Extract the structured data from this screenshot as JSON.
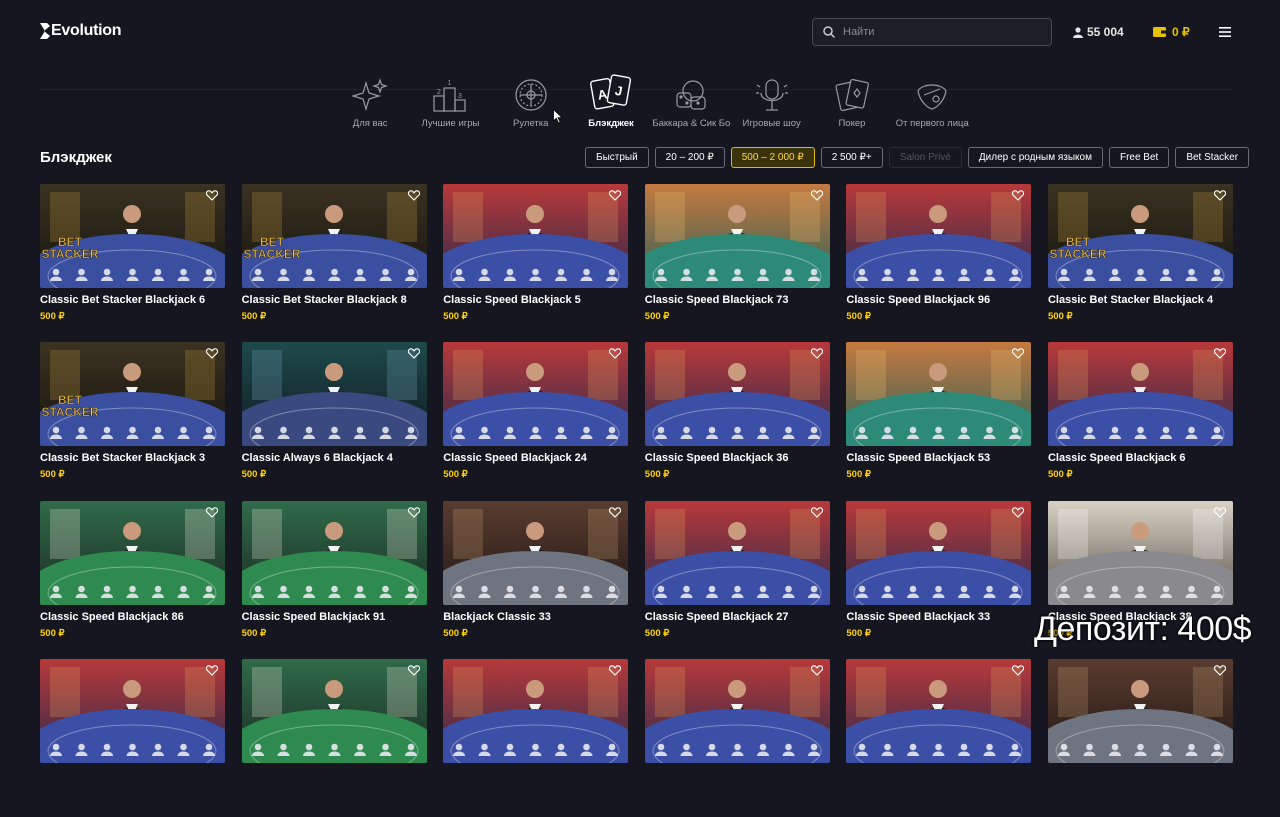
{
  "brand": "Evolution",
  "search": {
    "placeholder": "Найти"
  },
  "header": {
    "players": "55 004",
    "balance": "0 ₽"
  },
  "categories": [
    {
      "label": "Для вас",
      "icon": "sparkles-icon",
      "active": false
    },
    {
      "label": "Лучшие игры",
      "icon": "podium-icon",
      "active": false
    },
    {
      "label": "Рулетка",
      "icon": "roulette-icon",
      "active": false
    },
    {
      "label": "Блэкджек",
      "icon": "cards-icon",
      "active": true
    },
    {
      "label": "Баккара & Сик Бо",
      "icon": "dice-icon",
      "active": false
    },
    {
      "label": "Игровые шоу",
      "icon": "microphone-icon",
      "active": false
    },
    {
      "label": "Покер",
      "icon": "poker-cards-icon",
      "active": false
    },
    {
      "label": "От первого лица",
      "icon": "first-person-icon",
      "active": false
    }
  ],
  "section": {
    "title": "Блэкджек"
  },
  "filters": [
    {
      "label": "Быстрый",
      "state": "normal"
    },
    {
      "label": "20 – 200 ₽",
      "state": "normal"
    },
    {
      "label": "500 – 2 000 ₽",
      "state": "selected"
    },
    {
      "label": "2 500 ₽+",
      "state": "normal"
    },
    {
      "label": "Salon Privé",
      "state": "disabled"
    },
    {
      "label": "Дилер с родным языком",
      "state": "normal"
    },
    {
      "label": "Free Bet",
      "state": "normal"
    },
    {
      "label": "Bet Stacker",
      "state": "normal"
    }
  ],
  "games": [
    {
      "title": "Classic Bet Stacker Blackjack 6",
      "price": "500 ₽",
      "theme": "stacker"
    },
    {
      "title": "Classic Bet Stacker Blackjack 8",
      "price": "500 ₽",
      "theme": "stacker"
    },
    {
      "title": "Classic Speed Blackjack 5",
      "price": "500 ₽",
      "theme": "speed"
    },
    {
      "title": "Classic Speed Blackjack 73",
      "price": "500 ₽",
      "theme": "green"
    },
    {
      "title": "Classic Speed Blackjack 96",
      "price": "500 ₽",
      "theme": "speed"
    },
    {
      "title": "Classic Bet Stacker Blackjack 4",
      "price": "500 ₽",
      "theme": "stacker"
    },
    {
      "title": "Classic Bet Stacker Blackjack 3",
      "price": "500 ₽",
      "theme": "stacker"
    },
    {
      "title": "Classic Always 6 Blackjack 4",
      "price": "500 ₽",
      "theme": "always6"
    },
    {
      "title": "Classic Speed Blackjack 24",
      "price": "500 ₽",
      "theme": "speed"
    },
    {
      "title": "Classic Speed Blackjack 36",
      "price": "500 ₽",
      "theme": "speed"
    },
    {
      "title": "Classic Speed Blackjack 53",
      "price": "500 ₽",
      "theme": "green"
    },
    {
      "title": "Classic Speed Blackjack 6",
      "price": "500 ₽",
      "theme": "speed"
    },
    {
      "title": "Classic Speed Blackjack 86",
      "price": "500 ₽",
      "theme": "greenroom"
    },
    {
      "title": "Classic Speed Blackjack 91",
      "price": "500 ₽",
      "theme": "greenroom"
    },
    {
      "title": "Blackjack Classic 33",
      "price": "500 ₽",
      "theme": "classic"
    },
    {
      "title": "Classic Speed Blackjack 27",
      "price": "500 ₽",
      "theme": "speed"
    },
    {
      "title": "Classic Speed Blackjack 33",
      "price": "500 ₽",
      "theme": "speed"
    },
    {
      "title": "Classic Speed Blackjack 38",
      "price": "500 ₽",
      "theme": "white"
    },
    {
      "title": "",
      "price": "",
      "theme": "speed"
    },
    {
      "title": "",
      "price": "",
      "theme": "greenroom"
    },
    {
      "title": "",
      "price": "",
      "theme": "speed"
    },
    {
      "title": "",
      "price": "",
      "theme": "speed"
    },
    {
      "title": "",
      "price": "",
      "theme": "speed"
    },
    {
      "title": "",
      "price": "",
      "theme": "classic"
    }
  ],
  "overlay_text": "Депозит: 400$",
  "colors": {
    "background": "#161620",
    "accent": "#e2b80e",
    "price": "#ffd200"
  }
}
